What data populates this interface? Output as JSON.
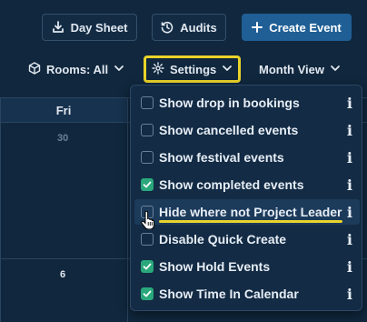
{
  "toolbar": {
    "day_sheet_label": "Day Sheet",
    "audits_label": "Audits",
    "create_event_label": "Create Event",
    "rooms_label": "Rooms: All",
    "settings_label": "Settings",
    "view_label": "Month View"
  },
  "calendar": {
    "day_header": "Fri",
    "dates": [
      "30",
      "6"
    ]
  },
  "settings_menu": {
    "items": [
      {
        "label": "Show drop in bookings",
        "checked": false,
        "info": "i"
      },
      {
        "label": "Show cancelled events",
        "checked": false,
        "info": "i"
      },
      {
        "label": "Show festival events",
        "checked": false,
        "info": "i"
      },
      {
        "label": "Show completed events",
        "checked": true,
        "info": "i"
      },
      {
        "label": "Hide where not Project Leader",
        "checked": false,
        "info": "i"
      },
      {
        "label": "Disable Quick Create",
        "checked": false,
        "info": "i"
      },
      {
        "label": "Show Hold Events",
        "checked": true,
        "info": "i"
      },
      {
        "label": "Show Time In Calendar",
        "checked": true,
        "info": "i"
      }
    ]
  },
  "colors": {
    "background": "#10273d",
    "primary": "#1f5f95",
    "highlight": "#e9d32a",
    "checked": "#2aa87c"
  }
}
